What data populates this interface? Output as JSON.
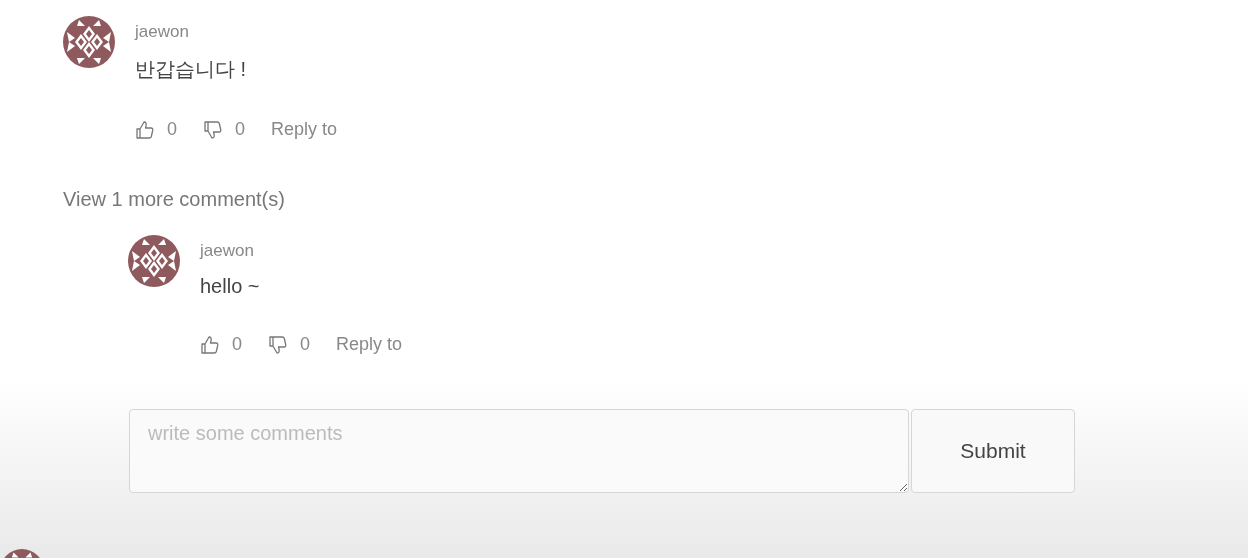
{
  "comments": [
    {
      "author": "jaewon",
      "text": "반갑습니다 !",
      "likes": "0",
      "dislikes": "0",
      "reply_label": "Reply to"
    }
  ],
  "more_link": "View 1 more comment(s)",
  "replies": [
    {
      "author": "jaewon",
      "text": "hello ~",
      "likes": "0",
      "dislikes": "0",
      "reply_label": "Reply to"
    }
  ],
  "form": {
    "placeholder": "write some comments",
    "submit": "Submit"
  }
}
